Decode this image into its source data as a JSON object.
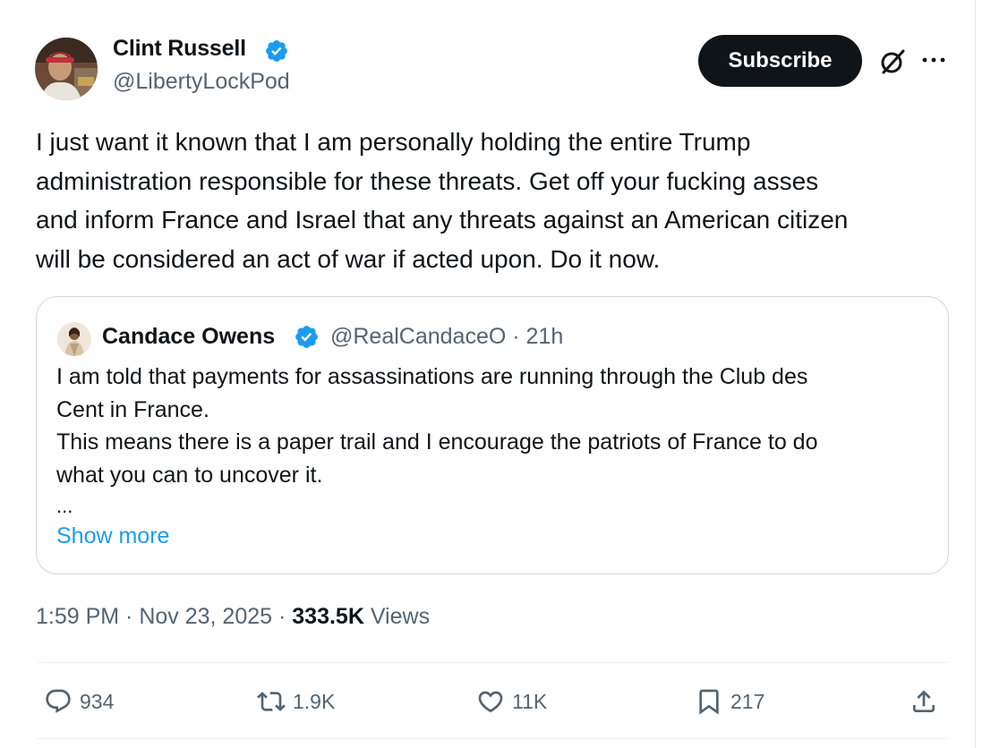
{
  "author": {
    "name": "Clint Russell",
    "handle": "@LibertyLockPod"
  },
  "header": {
    "subscribe_label": "Subscribe"
  },
  "tweet": {
    "lines": [
      "I just want it known that I am personally holding the entire Trump",
      "administration responsible for these threats. Get off your fucking asses",
      "and inform France and Israel that any threats against an American citizen",
      "will be considered an act of war if acted upon. Do it now."
    ]
  },
  "quote": {
    "name": "Candace Owens",
    "handle_time": "@RealCandaceO · 21h",
    "lines": [
      "I am told that payments for assassinations are running through the Club des",
      "Cent in France.",
      "This means there is a paper trail and I encourage the patriots of France to do",
      "what you can to uncover it."
    ],
    "ellipsis": "...",
    "show_more": "Show more"
  },
  "meta": {
    "time": "1:59 PM",
    "sep1": " · ",
    "date": "Nov 23, 2025",
    "sep2": " · ",
    "views_count": "333.5K",
    "views_label": " Views"
  },
  "actions": {
    "replies": "934",
    "reposts": "1.9K",
    "likes": "11K",
    "bookmarks": "217"
  },
  "colors": {
    "accent": "#1d9bf0",
    "text": "#0f1419",
    "secondary": "#536471",
    "border": "#cfd9de"
  },
  "icons": [
    "verified-badge-icon",
    "grok-icon",
    "more-icon",
    "reply-icon",
    "repost-icon",
    "like-icon",
    "bookmark-icon",
    "share-icon"
  ]
}
